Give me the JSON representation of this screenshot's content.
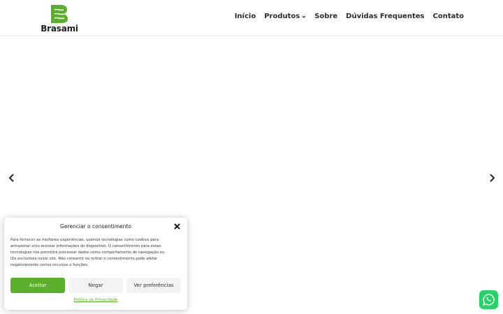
{
  "brand": {
    "name": "Brasami",
    "color": "#5bb02b"
  },
  "nav": {
    "items": [
      {
        "label": "Início"
      },
      {
        "label": "Produtos",
        "has_dropdown": true
      },
      {
        "label": "Sobre"
      },
      {
        "label": "Dúvidas Frequentes"
      },
      {
        "label": "Contato"
      }
    ]
  },
  "slider": {
    "prev_icon": "chevron-left-icon",
    "next_icon": "chevron-right-icon"
  },
  "consent": {
    "title": "Gerenciar o consentimento",
    "body_lines": [
      "Para fornecer as melhores experiências, usamos tecnologias como cookies para",
      "armazenar e/ou acessar informações do dispositivo. O consentimento para essas",
      "tecnologias nos permitirá processar dados como comportamento de navegação ou",
      "IDs exclusivos neste site. Não consentir ou retirar o consentimento pode afetar",
      "negativamente certos recursos e funções."
    ],
    "accept_label": "Aceitar",
    "deny_label": "Negar",
    "prefs_label": "Ver preferências",
    "privacy_link": "Política de Privacidade",
    "accept_color": "#5bb02b"
  },
  "whatsapp": {
    "icon": "whatsapp-icon",
    "color": "#25d366"
  }
}
